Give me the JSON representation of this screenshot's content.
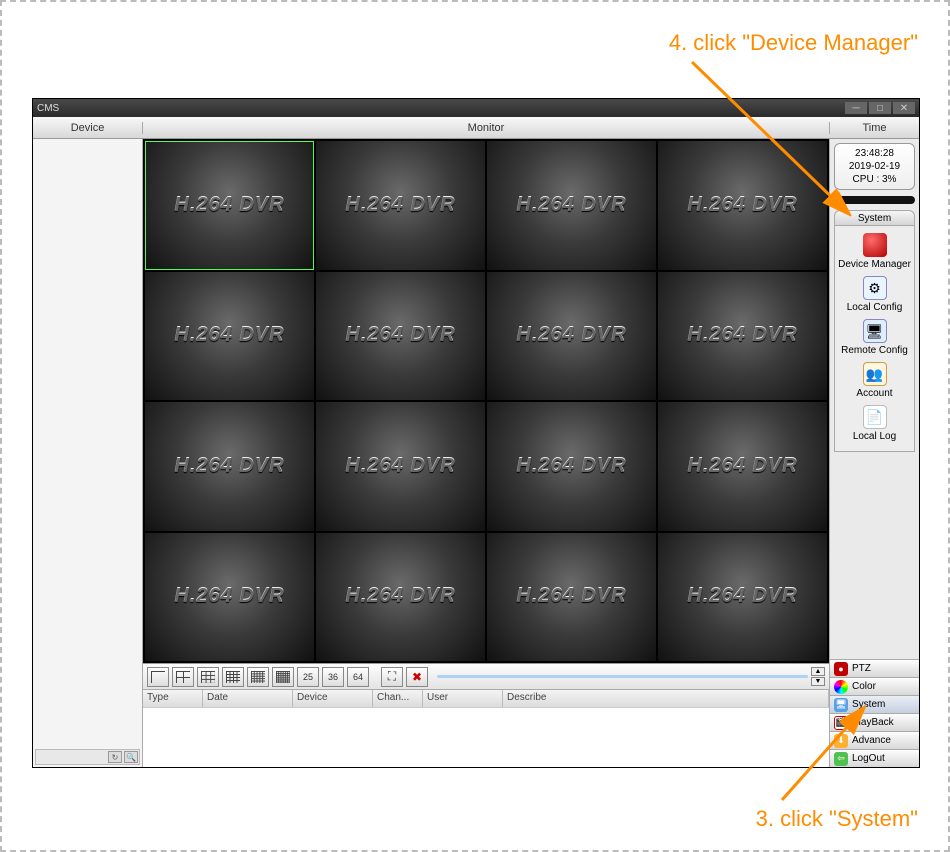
{
  "annotations": {
    "top": "4. click \"Device Manager\"",
    "bottom": "3. click \"System\""
  },
  "titlebar": {
    "title": "CMS"
  },
  "header": {
    "device": "Device",
    "monitor": "Monitor",
    "time": "Time"
  },
  "time_panel": {
    "clock": "23:48:28",
    "date": "2019-02-19",
    "cpu": "CPU : 3%"
  },
  "system_panel": {
    "title": "System",
    "items": [
      {
        "label": "Device Manager"
      },
      {
        "label": "Local Config"
      },
      {
        "label": "Remote Config"
      },
      {
        "label": "Account"
      },
      {
        "label": "Local Log"
      }
    ]
  },
  "nav_tabs": [
    {
      "label": "PTZ"
    },
    {
      "label": "Color"
    },
    {
      "label": "System"
    },
    {
      "label": "PlayBack"
    },
    {
      "label": "Advance"
    },
    {
      "label": "LogOut"
    }
  ],
  "grid": {
    "cell_label": "H.264 DVR",
    "count": 16
  },
  "view_buttons": {
    "n25": "25",
    "n36": "36",
    "n64": "64"
  },
  "event_cols": {
    "type": "Type",
    "date": "Date",
    "device": "Device",
    "chan": "Chan...",
    "user": "User",
    "describe": "Describe"
  }
}
